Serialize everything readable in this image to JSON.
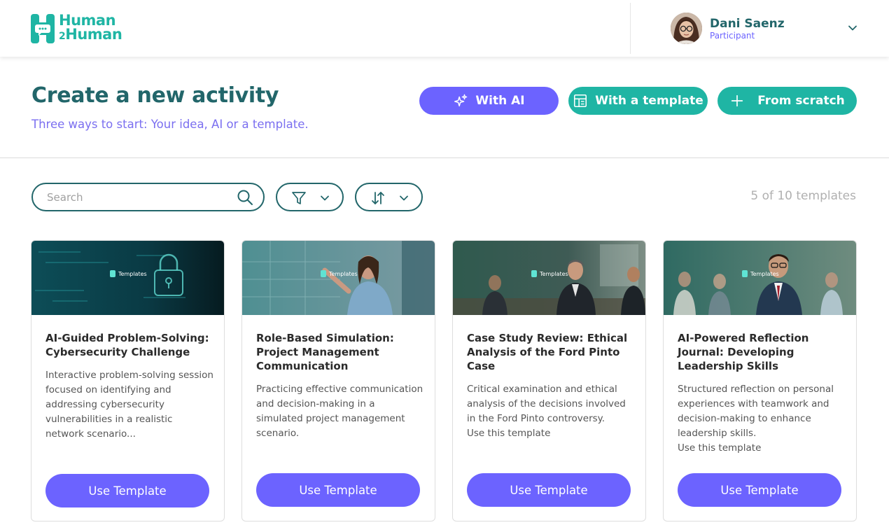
{
  "brand": {
    "line1": "Human",
    "line2a": "2",
    "line2b": "Human",
    "teal": "#1fb5a4",
    "dark_teal": "#22666a",
    "purple": "#6c63ff"
  },
  "user": {
    "name": "Dani Saenz",
    "role": "Participant"
  },
  "hero": {
    "title": "Create a new activity",
    "subtitle": "Three ways to start: Your idea, AI or a template.",
    "buttons": {
      "ai": "With AI",
      "template": "With a template",
      "scratch": "From scratch"
    }
  },
  "toolbar": {
    "search_placeholder": "Search",
    "count": "5 of 10 templates"
  },
  "thumb_label": "Templates",
  "cards": [
    {
      "title": "AI-Guided Problem-Solving: Cybersecurity Challenge",
      "description": "Interactive problem-solving session focused on identifying and addressing cybersecurity vulnerabilities in a realistic network scenario...",
      "button": "Use Template"
    },
    {
      "title": "Role-Based Simulation: Project Management Communication",
      "description": "Practicing effective communication and decision-making in a simulated project management scenario.",
      "button": "Use Template"
    },
    {
      "title": "Case Study Review: Ethical Analysis of the Ford Pinto Case",
      "description": "Critical examination and ethical analysis of the decisions involved in the Ford Pinto controversy.",
      "link": "Use this template",
      "button": "Use Template"
    },
    {
      "title": "AI-Powered Reflection Journal: Developing Leadership Skills",
      "description": "Structured reflection on personal experiences with teamwork and decision-making to enhance leadership skills.",
      "link": "Use this template",
      "button": "Use Template"
    }
  ]
}
